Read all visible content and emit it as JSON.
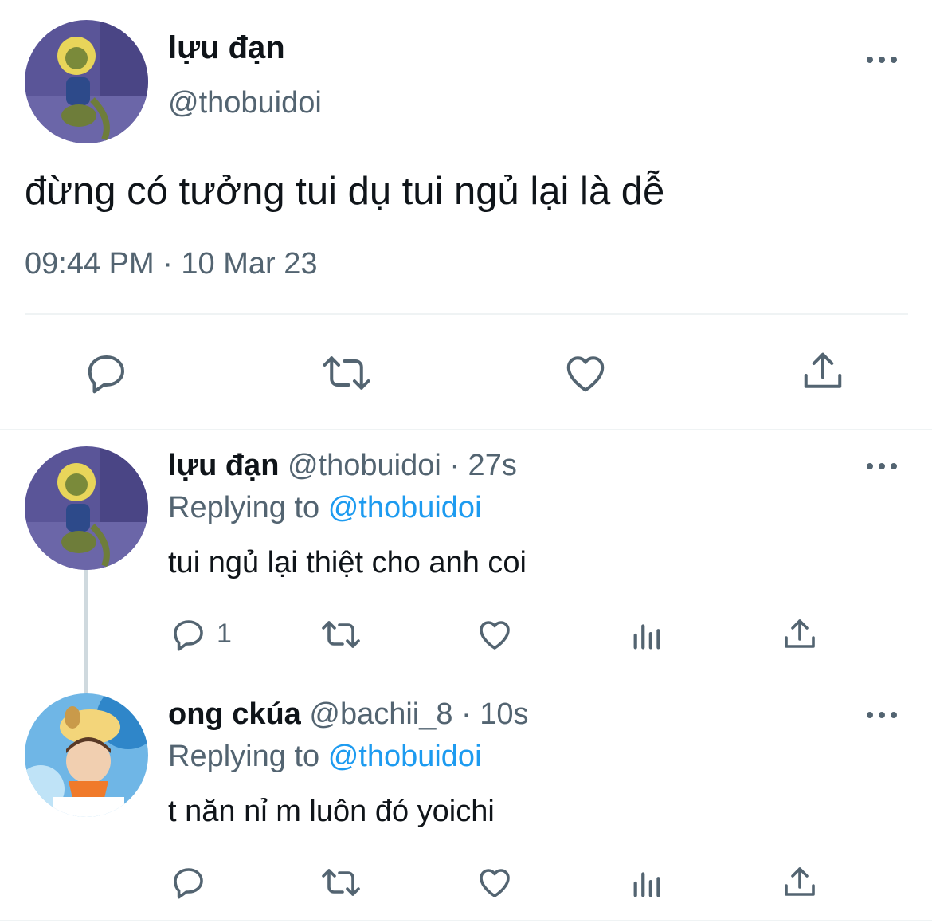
{
  "main_tweet": {
    "display_name": "lựu đạn",
    "handle": "@thobuidoi",
    "text": "đừng có tưởng tui dụ tui ngủ lại là dễ",
    "timestamp": "09:44 PM · 10 Mar 23"
  },
  "replies": [
    {
      "display_name": "lựu đạn",
      "handle_time": "@thobuidoi · 27s",
      "replying_prefix": "Replying to",
      "replying_to": "@thobuidoi",
      "text": "tui ngủ lại thiệt cho anh coi",
      "reply_count": "1"
    },
    {
      "display_name": "ong ckúa",
      "handle_time": "@bachii_8 · 10s",
      "replying_prefix": "Replying to",
      "replying_to": "@thobuidoi",
      "text": "t năn nỉ m luôn đó yoichi",
      "reply_count": ""
    }
  ],
  "colors": {
    "accent": "#1d9bf0",
    "muted": "#536471",
    "text": "#0f1419",
    "divider": "#eff3f4"
  }
}
